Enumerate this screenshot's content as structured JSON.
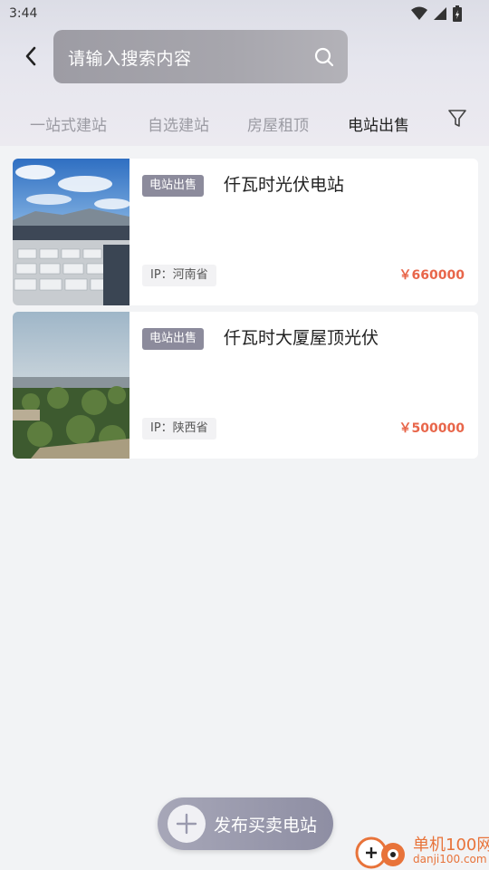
{
  "status_bar": {
    "time": "3:44"
  },
  "header": {
    "search": {
      "placeholder": "请输入搜索内容"
    },
    "tabs": [
      {
        "label": "一站式建站",
        "active": false
      },
      {
        "label": "自选建站",
        "active": false
      },
      {
        "label": "房屋租顶",
        "active": false
      },
      {
        "label": "电站出售",
        "active": true
      }
    ]
  },
  "listings": [
    {
      "badge": "电站出售",
      "title": "仟瓦时光伏电站",
      "ip": "IP：河南省",
      "price": "￥660000"
    },
    {
      "badge": "电站出售",
      "title": "仟瓦时大厦屋顶光伏",
      "ip": "IP：陕西省",
      "price": "￥500000"
    }
  ],
  "publish_button": {
    "label": "发布买卖电站"
  },
  "watermark": {
    "title": "单机100网",
    "url": "danji100.com"
  },
  "colors": {
    "accent_price": "#e8664a",
    "badge_bg": "#8c8b9c",
    "background": "#f2f3f5"
  }
}
